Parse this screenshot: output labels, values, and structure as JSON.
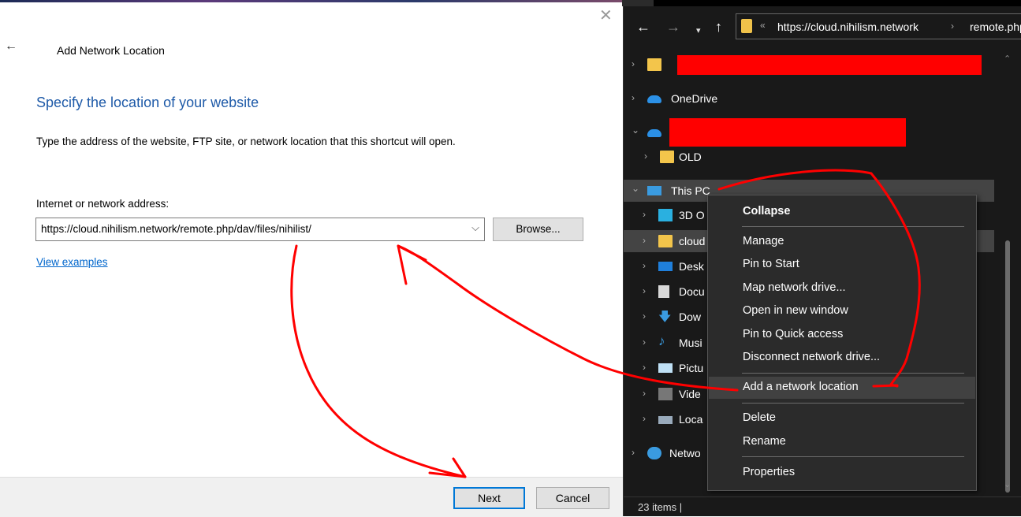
{
  "wizard": {
    "window_title": "Add Network Location",
    "heading": "Specify the location of your website",
    "description": "Type the address of the website, FTP site, or network location that this shortcut will open.",
    "address_label": "Internet or network address:",
    "address_value": "https://cloud.nihilism.network/remote.php/dav/files/nihilist/",
    "browse_label": "Browse...",
    "examples_link": "View examples",
    "next_label": "Next",
    "cancel_label": "Cancel"
  },
  "explorer": {
    "address_seg1": "https://cloud.nihilism.network",
    "address_seg2": "remote.php",
    "tree": [
      {
        "label": "",
        "icon": "folder-icon",
        "expanded": false,
        "redacted": true
      },
      {
        "label": "OneDrive",
        "icon": "onedrive-icon",
        "expanded": false
      },
      {
        "label": "",
        "icon": "onedrive-icon",
        "expanded": true,
        "redacted": true
      },
      {
        "label": "OLD",
        "icon": "folder-icon",
        "expanded": false
      },
      {
        "label": "This PC",
        "icon": "computer-icon",
        "expanded": true
      },
      {
        "label": "3D O",
        "icon": "3d-objects-icon",
        "expanded": false
      },
      {
        "label": "cloud",
        "icon": "network-drive-icon",
        "expanded": false
      },
      {
        "label": "Desk",
        "icon": "desktop-icon",
        "expanded": false
      },
      {
        "label": "Docu",
        "icon": "documents-icon",
        "expanded": false
      },
      {
        "label": "Dow",
        "icon": "downloads-icon",
        "expanded": false
      },
      {
        "label": "Musi",
        "icon": "music-icon",
        "expanded": false
      },
      {
        "label": "Pictu",
        "icon": "pictures-icon",
        "expanded": false
      },
      {
        "label": "Vide",
        "icon": "videos-icon",
        "expanded": false
      },
      {
        "label": "Loca",
        "icon": "local-disk-icon",
        "expanded": false
      },
      {
        "label": "Netwo",
        "icon": "network-icon",
        "expanded": false
      }
    ],
    "status": "23 items  |"
  },
  "context_menu": {
    "items": [
      {
        "label": "Collapse",
        "bold": true
      },
      {
        "label": "Manage"
      },
      {
        "label": "Pin to Start"
      },
      {
        "label": "Map network drive..."
      },
      {
        "label": "Open in new window"
      },
      {
        "label": "Pin to Quick access"
      },
      {
        "label": "Disconnect network drive..."
      },
      {
        "label": "Add a network location",
        "highlighted": true
      },
      {
        "label": "Delete"
      },
      {
        "label": "Rename"
      },
      {
        "label": "Properties"
      }
    ]
  },
  "colors": {
    "annotation_red": "#ff0000",
    "link_blue": "#0066cc",
    "heading_blue": "#1e5aa8",
    "explorer_bg": "#191919",
    "menu_bg": "#2b2b2b"
  }
}
